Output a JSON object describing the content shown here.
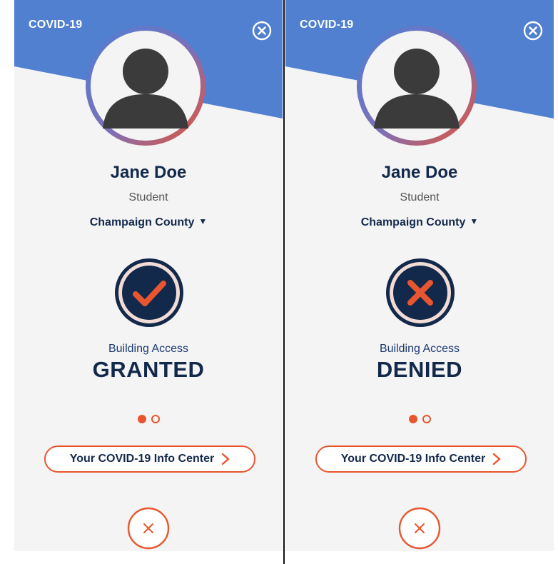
{
  "colors": {
    "banner_blue": "#5080cf",
    "navy": "#13294b",
    "orange": "#e8552f",
    "background": "#f4f4f4"
  },
  "screens": [
    {
      "header": {
        "title": "COVID-19",
        "close_icon": "close-circle-icon"
      },
      "profile": {
        "avatar_icon": "person-silhouette-icon",
        "name": "Jane Doe",
        "role": "Student"
      },
      "county_selector": {
        "label": "Champaign County",
        "icon": "caret-down-icon"
      },
      "access": {
        "icon": "checkmark-badge-icon",
        "label": "Building Access",
        "status": "GRANTED"
      },
      "pager": {
        "current": 1,
        "total": 2
      },
      "info_button": {
        "label": "Your COVID-19 Info Center",
        "icon": "chevron-right-icon"
      },
      "dismiss": {
        "icon": "close-x-icon"
      }
    },
    {
      "header": {
        "title": "COVID-19",
        "close_icon": "close-circle-icon"
      },
      "profile": {
        "avatar_icon": "person-silhouette-icon",
        "name": "Jane Doe",
        "role": "Student"
      },
      "county_selector": {
        "label": "Champaign County",
        "icon": "caret-down-icon"
      },
      "access": {
        "icon": "x-badge-icon",
        "label": "Building Access",
        "status": "DENIED"
      },
      "pager": {
        "current": 1,
        "total": 2
      },
      "info_button": {
        "label": "Your COVID-19 Info Center",
        "icon": "chevron-right-icon"
      },
      "dismiss": {
        "icon": "close-x-icon"
      }
    }
  ]
}
